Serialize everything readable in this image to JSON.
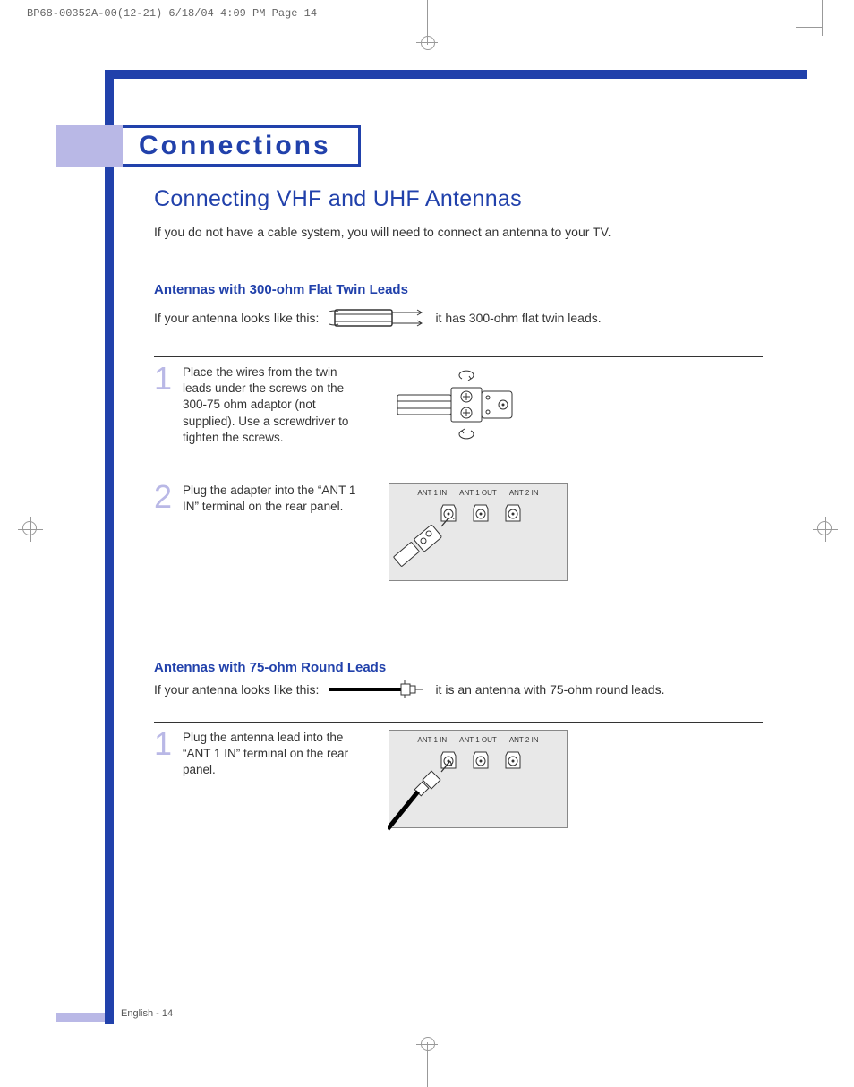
{
  "print_header": "BP68-00352A-00(12-21)  6/18/04  4:09 PM  Page 14",
  "title": "Connections",
  "subtitle": "Connecting VHF and UHF Antennas",
  "intro": "If you do not have a cable system, you will need to connect an antenna to your TV.",
  "section1": {
    "heading": "Antennas with 300-ohm Flat Twin Leads",
    "lead_before": "If your antenna looks like this:",
    "lead_after": "it has 300-ohm flat twin leads.",
    "steps": [
      {
        "num": "1",
        "text": "Place the wires from the twin leads under the screws on the 300-75 ohm adaptor (not supplied). Use a screwdriver to tighten the screws."
      },
      {
        "num": "2",
        "text": "Plug the adapter into the “ANT 1 IN” terminal on the rear panel."
      }
    ]
  },
  "section2": {
    "heading": "Antennas with 75-ohm Round Leads",
    "lead_before": "If your antenna looks like this:",
    "lead_after": "it is an antenna with 75-ohm round leads.",
    "steps": [
      {
        "num": "1",
        "text": "Plug the antenna lead into the “ANT 1 IN” terminal on the rear panel."
      }
    ]
  },
  "panel_labels": [
    "ANT 1 IN",
    "ANT 1 OUT",
    "ANT 2 IN"
  ],
  "footer": "English - 14"
}
